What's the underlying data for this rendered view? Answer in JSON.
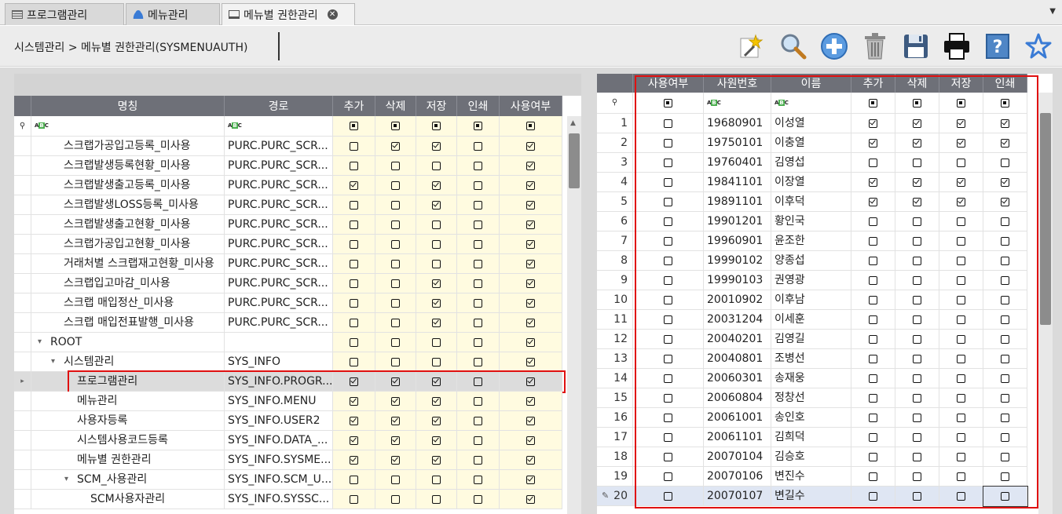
{
  "tabs": [
    {
      "label": "프로그램관리",
      "icon": "list-icon",
      "active": false
    },
    {
      "label": "메뉴관리",
      "icon": "users-icon",
      "active": false
    },
    {
      "label": "메뉴별 권한관리",
      "icon": "monitor-icon",
      "active": true
    }
  ],
  "breadcrumb": "시스템관리 > 메뉴별 권한관리(SYSMENUAUTH)",
  "toolbar_icons": [
    "new-icon",
    "search-icon",
    "add-icon",
    "delete-icon",
    "save-icon",
    "print-icon",
    "help-icon",
    "favorite-icon"
  ],
  "left_grid": {
    "columns": [
      "명칭",
      "경로",
      "추가",
      "삭제",
      "저장",
      "인쇄",
      "사용여부"
    ],
    "rows": [
      {
        "name": "스크랩가공입고등록_미사용",
        "path": "PURC.PURC_SCR...",
        "level": 1,
        "expander": "",
        "add": false,
        "del": true,
        "save": true,
        "print": false,
        "use": true
      },
      {
        "name": "스크랩발생등록현황_미사용",
        "path": "PURC.PURC_SCR...",
        "level": 1,
        "expander": "",
        "add": false,
        "del": false,
        "save": false,
        "print": false,
        "use": true
      },
      {
        "name": "스크랩발생출고등록_미사용",
        "path": "PURC.PURC_SCR...",
        "level": 1,
        "expander": "",
        "add": true,
        "del": false,
        "save": true,
        "print": false,
        "use": true
      },
      {
        "name": "스크랩발생LOSS등록_미사용",
        "path": "PURC.PURC_SCR...",
        "level": 1,
        "expander": "",
        "add": false,
        "del": false,
        "save": true,
        "print": false,
        "use": true
      },
      {
        "name": "스크랩발생출고현황_미사용",
        "path": "PURC.PURC_SCR...",
        "level": 1,
        "expander": "",
        "add": false,
        "del": false,
        "save": false,
        "print": false,
        "use": true
      },
      {
        "name": "스크랩가공입고현황_미사용",
        "path": "PURC.PURC_SCR...",
        "level": 1,
        "expander": "",
        "add": false,
        "del": false,
        "save": false,
        "print": false,
        "use": true
      },
      {
        "name": "거래처별 스크랩재고현황_미사용",
        "path": "PURC.PURC_SCR...",
        "level": 1,
        "expander": "",
        "add": false,
        "del": false,
        "save": false,
        "print": false,
        "use": true
      },
      {
        "name": "스크랩입고마감_미사용",
        "path": "PURC.PURC_SCR...",
        "level": 1,
        "expander": "",
        "add": false,
        "del": false,
        "save": true,
        "print": false,
        "use": true
      },
      {
        "name": "스크랩 매입정산_미사용",
        "path": "PURC.PURC_SCR...",
        "level": 1,
        "expander": "",
        "add": false,
        "del": false,
        "save": true,
        "print": false,
        "use": true
      },
      {
        "name": "스크랩 매입전표발행_미사용",
        "path": "PURC.PURC_SCR...",
        "level": 1,
        "expander": "",
        "add": false,
        "del": false,
        "save": true,
        "print": false,
        "use": true
      },
      {
        "name": "ROOT",
        "path": "",
        "level": 0,
        "expander": "▾",
        "add": false,
        "del": false,
        "save": false,
        "print": false,
        "use": true
      },
      {
        "name": "시스템관리",
        "path": "SYS_INFO",
        "level": 1,
        "expander": "▾",
        "add": false,
        "del": false,
        "save": false,
        "print": false,
        "use": true
      },
      {
        "name": "프로그램관리",
        "path": "SYS_INFO.PROGR...",
        "level": 2,
        "expander": "",
        "add": true,
        "del": true,
        "save": true,
        "print": false,
        "use": true,
        "selected": true
      },
      {
        "name": "메뉴관리",
        "path": "SYS_INFO.MENU",
        "level": 2,
        "expander": "",
        "add": true,
        "del": true,
        "save": true,
        "print": false,
        "use": true
      },
      {
        "name": "사용자등록",
        "path": "SYS_INFO.USER2",
        "level": 2,
        "expander": "",
        "add": true,
        "del": true,
        "save": true,
        "print": false,
        "use": true
      },
      {
        "name": "시스템사용코드등록",
        "path": "SYS_INFO.DATA_...",
        "level": 2,
        "expander": "",
        "add": true,
        "del": true,
        "save": true,
        "print": false,
        "use": true
      },
      {
        "name": "메뉴별 권한관리",
        "path": "SYS_INFO.SYSME...",
        "level": 2,
        "expander": "",
        "add": true,
        "del": true,
        "save": true,
        "print": false,
        "use": true
      },
      {
        "name": "SCM_사용관리",
        "path": "SYS_INFO.SCM_U...",
        "level": 2,
        "expander": "▾",
        "add": false,
        "del": false,
        "save": false,
        "print": false,
        "use": true
      },
      {
        "name": "SCM사용자관리",
        "path": "SYS_INFO.SYSSC...",
        "level": 3,
        "expander": "",
        "add": false,
        "del": false,
        "save": false,
        "print": false,
        "use": true
      }
    ]
  },
  "right_grid": {
    "columns": [
      "사용여부",
      "사원번호",
      "이름",
      "추가",
      "삭제",
      "저장",
      "인쇄"
    ],
    "rows": [
      {
        "no": "1",
        "use": false,
        "emp": "19680901",
        "name": "이성열",
        "add": true,
        "del": true,
        "save": true,
        "print": true
      },
      {
        "no": "2",
        "use": false,
        "emp": "19750101",
        "name": "이충열",
        "add": true,
        "del": true,
        "save": true,
        "print": true
      },
      {
        "no": "3",
        "use": false,
        "emp": "19760401",
        "name": "김영섭",
        "add": false,
        "del": false,
        "save": false,
        "print": false
      },
      {
        "no": "4",
        "use": false,
        "emp": "19841101",
        "name": "이장열",
        "add": true,
        "del": true,
        "save": true,
        "print": true
      },
      {
        "no": "5",
        "use": false,
        "emp": "19891101",
        "name": "이후덕",
        "add": true,
        "del": true,
        "save": true,
        "print": true
      },
      {
        "no": "6",
        "use": false,
        "emp": "19901201",
        "name": "황인국",
        "add": false,
        "del": false,
        "save": false,
        "print": false
      },
      {
        "no": "7",
        "use": false,
        "emp": "19960901",
        "name": "윤조한",
        "add": false,
        "del": false,
        "save": false,
        "print": false
      },
      {
        "no": "8",
        "use": false,
        "emp": "19990102",
        "name": "양종섭",
        "add": false,
        "del": false,
        "save": false,
        "print": false
      },
      {
        "no": "9",
        "use": false,
        "emp": "19990103",
        "name": "권영광",
        "add": false,
        "del": false,
        "save": false,
        "print": false
      },
      {
        "no": "10",
        "use": false,
        "emp": "20010902",
        "name": "이후남",
        "add": false,
        "del": false,
        "save": false,
        "print": false
      },
      {
        "no": "11",
        "use": false,
        "emp": "20031204",
        "name": "이세훈",
        "add": false,
        "del": false,
        "save": false,
        "print": false
      },
      {
        "no": "12",
        "use": false,
        "emp": "20040201",
        "name": "김영길",
        "add": false,
        "del": false,
        "save": false,
        "print": false
      },
      {
        "no": "13",
        "use": false,
        "emp": "20040801",
        "name": "조병선",
        "add": false,
        "del": false,
        "save": false,
        "print": false
      },
      {
        "no": "14",
        "use": false,
        "emp": "20060301",
        "name": "송재웅",
        "add": false,
        "del": false,
        "save": false,
        "print": false
      },
      {
        "no": "15",
        "use": false,
        "emp": "20060804",
        "name": "정창선",
        "add": false,
        "del": false,
        "save": false,
        "print": false
      },
      {
        "no": "16",
        "use": false,
        "emp": "20061001",
        "name": "송인호",
        "add": false,
        "del": false,
        "save": false,
        "print": false
      },
      {
        "no": "17",
        "use": false,
        "emp": "20061101",
        "name": "김희덕",
        "add": false,
        "del": false,
        "save": false,
        "print": false
      },
      {
        "no": "18",
        "use": false,
        "emp": "20070104",
        "name": "김승호",
        "add": false,
        "del": false,
        "save": false,
        "print": false
      },
      {
        "no": "19",
        "use": false,
        "emp": "20070106",
        "name": "변진수",
        "add": false,
        "del": false,
        "save": false,
        "print": false
      },
      {
        "no": "20",
        "use": false,
        "emp": "20070107",
        "name": "변길수",
        "add": false,
        "del": false,
        "save": false,
        "print": false,
        "editing": true
      }
    ]
  },
  "colors": {
    "header_bg": "#6e7078",
    "check_col_bg": "#fffbe0",
    "selected_row_bg": "#dcdcdc",
    "highlight_border": "#e01010",
    "editing_row_bg": "#dfe6f3"
  }
}
